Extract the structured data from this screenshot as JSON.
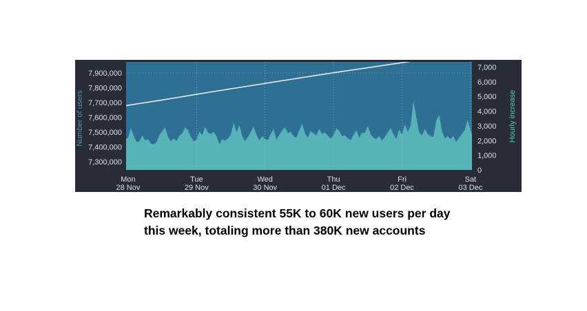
{
  "colors": {
    "panel_bg": "#282c37",
    "plot_bg": "#2e6f94",
    "area_fill": "#56b3b8",
    "total_line": "#e8e8f5",
    "grid": "#aab4c0",
    "left_axis_title": "#5a8fa8",
    "right_axis_title": "#56c7b4"
  },
  "caption": {
    "line1": "Remarkably consistent 55K to 60K new users per day",
    "line2": "this week, totaling more than 380K new accounts"
  },
  "chart_data": {
    "type": "area",
    "ylabel_left": "Number of users",
    "ylabel_right": "Hourly increase",
    "y_left_ticks": [
      "7,300,000",
      "7,400,000",
      "7,500,000",
      "7,600,000",
      "7,700,000",
      "7,800,000",
      "7,900,000"
    ],
    "y_left_tick_values": [
      7300000,
      7400000,
      7500000,
      7600000,
      7700000,
      7800000,
      7900000
    ],
    "ylim_left": [
      7245000,
      7975000
    ],
    "y_right_ticks": [
      "0",
      "1,000",
      "2,000",
      "3,000",
      "4,000",
      "5,000",
      "6,000",
      "7,000"
    ],
    "y_right_tick_values": [
      0,
      1000,
      2000,
      3000,
      4000,
      5000,
      6000,
      7000
    ],
    "ylim_right": [
      0,
      7350
    ],
    "x_ticks": [
      {
        "day": "Mon",
        "date": "28 Nov",
        "hour": 0
      },
      {
        "day": "Tue",
        "date": "29 Nov",
        "hour": 24
      },
      {
        "day": "Wed",
        "date": "30 Nov",
        "hour": 48
      },
      {
        "day": "Thu",
        "date": "01 Dec",
        "hour": 72
      },
      {
        "day": "Fri",
        "date": "02 Dec",
        "hour": 96
      },
      {
        "day": "Sat",
        "date": "03 Dec",
        "hour": 120
      }
    ],
    "xlim_hours": [
      -0.7,
      120.5
    ],
    "grid": "vertical dotted at day ticks, horizontal dotted at top",
    "series": [
      {
        "name": "Number of users",
        "axis": "left",
        "style": "line",
        "points": [
          [
            -0.7,
            7680000
          ],
          [
            12,
            7718000
          ],
          [
            24,
            7756000
          ],
          [
            36,
            7793000
          ],
          [
            48,
            7830000
          ],
          [
            60,
            7866000
          ],
          [
            72,
            7902000
          ],
          [
            84,
            7936000
          ],
          [
            96,
            7970000
          ],
          [
            108,
            8004000
          ],
          [
            120.5,
            8040000
          ]
        ]
      },
      {
        "name": "Hourly increase",
        "axis": "right",
        "style": "area",
        "points": [
          [
            -0.7,
            2100
          ],
          [
            0,
            2200
          ],
          [
            1,
            2850
          ],
          [
            2,
            2300
          ],
          [
            3,
            1900
          ],
          [
            4,
            1950
          ],
          [
            5,
            2350
          ],
          [
            6,
            2000
          ],
          [
            7,
            2100
          ],
          [
            8,
            1800
          ],
          [
            9,
            1750
          ],
          [
            10,
            1900
          ],
          [
            11,
            2400
          ],
          [
            12,
            2650
          ],
          [
            13,
            2900
          ],
          [
            14,
            2250
          ],
          [
            15,
            1950
          ],
          [
            16,
            2150
          ],
          [
            17,
            1950
          ],
          [
            18,
            2350
          ],
          [
            19,
            2500
          ],
          [
            20,
            2900
          ],
          [
            21,
            2700
          ],
          [
            22,
            2250
          ],
          [
            23,
            1950
          ],
          [
            24,
            2050
          ],
          [
            25,
            2600
          ],
          [
            26,
            2350
          ],
          [
            27,
            2950
          ],
          [
            28,
            2550
          ],
          [
            29,
            2450
          ],
          [
            30,
            2600
          ],
          [
            31,
            2300
          ],
          [
            32,
            1750
          ],
          [
            33,
            2100
          ],
          [
            34,
            2000
          ],
          [
            35,
            2150
          ],
          [
            36,
            2400
          ],
          [
            37,
            3200
          ],
          [
            38,
            2550
          ],
          [
            39,
            3050
          ],
          [
            40,
            2300
          ],
          [
            41,
            1950
          ],
          [
            42,
            2250
          ],
          [
            43,
            2600
          ],
          [
            44,
            2950
          ],
          [
            45,
            2400
          ],
          [
            46,
            2000
          ],
          [
            47,
            2300
          ],
          [
            48,
            2100
          ],
          [
            49,
            2050
          ],
          [
            50,
            2450
          ],
          [
            51,
            2800
          ],
          [
            52,
            2050
          ],
          [
            53,
            2400
          ],
          [
            54,
            2700
          ],
          [
            55,
            2900
          ],
          [
            56,
            2500
          ],
          [
            57,
            2600
          ],
          [
            58,
            2300
          ],
          [
            59,
            2200
          ],
          [
            60,
            2700
          ],
          [
            61,
            3150
          ],
          [
            62,
            2500
          ],
          [
            63,
            2200
          ],
          [
            64,
            2650
          ],
          [
            65,
            2500
          ],
          [
            66,
            2350
          ],
          [
            67,
            2800
          ],
          [
            68,
            2450
          ],
          [
            69,
            2550
          ],
          [
            70,
            2350
          ],
          [
            71,
            2150
          ],
          [
            72,
            2350
          ],
          [
            73,
            2850
          ],
          [
            74,
            2650
          ],
          [
            75,
            2300
          ],
          [
            76,
            2350
          ],
          [
            77,
            2150
          ],
          [
            78,
            2050
          ],
          [
            79,
            2400
          ],
          [
            80,
            2700
          ],
          [
            81,
            2200
          ],
          [
            82,
            2550
          ],
          [
            83,
            2500
          ],
          [
            84,
            3000
          ],
          [
            85,
            2400
          ],
          [
            86,
            2200
          ],
          [
            87,
            2100
          ],
          [
            88,
            2300
          ],
          [
            89,
            2000
          ],
          [
            90,
            2250
          ],
          [
            91,
            2550
          ],
          [
            92,
            2850
          ],
          [
            93,
            2450
          ],
          [
            94,
            2100
          ],
          [
            95,
            2750
          ],
          [
            96,
            2400
          ],
          [
            97,
            3100
          ],
          [
            98,
            2600
          ],
          [
            99,
            3000
          ],
          [
            100,
            4700
          ],
          [
            101,
            3600
          ],
          [
            102,
            2550
          ],
          [
            103,
            2350
          ],
          [
            104,
            2800
          ],
          [
            105,
            2450
          ],
          [
            106,
            2300
          ],
          [
            107,
            2250
          ],
          [
            108,
            3350
          ],
          [
            109,
            3750
          ],
          [
            110,
            2650
          ],
          [
            111,
            2150
          ],
          [
            112,
            2300
          ],
          [
            113,
            2100
          ],
          [
            114,
            2300
          ],
          [
            115,
            1900
          ],
          [
            116,
            2200
          ],
          [
            117,
            2450
          ],
          [
            118,
            2750
          ],
          [
            119,
            3400
          ],
          [
            120,
            2700
          ],
          [
            120.5,
            2400
          ]
        ]
      }
    ]
  }
}
